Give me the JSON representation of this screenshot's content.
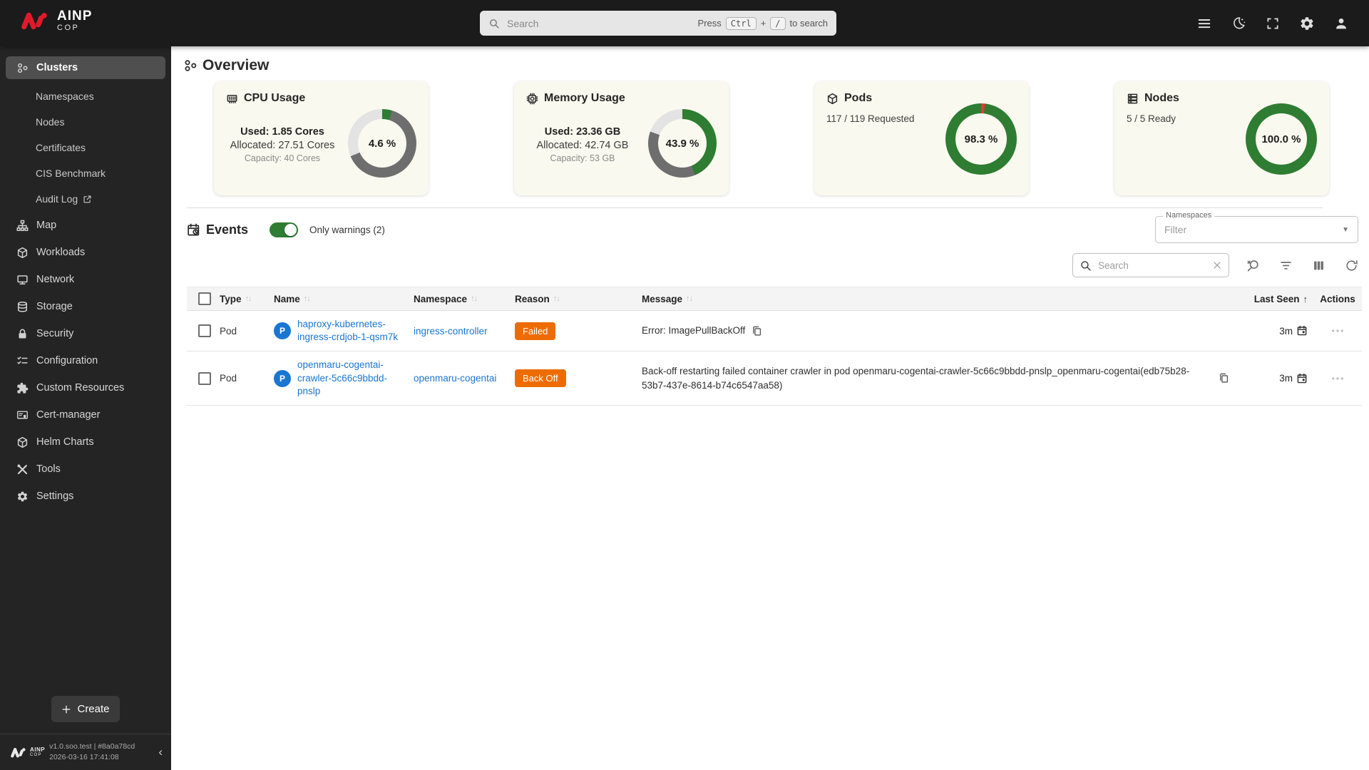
{
  "topbar": {
    "logo": {
      "primary": "AINP",
      "secondary": "COP"
    },
    "search": {
      "placeholder": "Search",
      "hint_press": "Press",
      "hint_key_ctrl": "Ctrl",
      "hint_plus": "+",
      "hint_key_slash": "/",
      "hint_suffix": "to search"
    }
  },
  "sidebar": {
    "items": [
      {
        "label": "Clusters",
        "icon": "cluster-icon",
        "selected": true
      },
      {
        "label": "Namespaces"
      },
      {
        "label": "Nodes"
      },
      {
        "label": "Certificates"
      },
      {
        "label": "CIS Benchmark"
      },
      {
        "label": "Audit Log",
        "icon": "external-link-icon"
      },
      {
        "label": "Map",
        "icon": "map-icon"
      },
      {
        "label": "Workloads",
        "icon": "workloads-icon"
      },
      {
        "label": "Network",
        "icon": "network-icon"
      },
      {
        "label": "Storage",
        "icon": "storage-icon"
      },
      {
        "label": "Security",
        "icon": "security-icon"
      },
      {
        "label": "Configuration",
        "icon": "configuration-icon"
      },
      {
        "label": "Custom Resources",
        "icon": "custom-resources-icon"
      },
      {
        "label": "Cert-manager",
        "icon": "cert-manager-icon"
      },
      {
        "label": "Helm Charts",
        "icon": "helm-charts-icon"
      },
      {
        "label": "Tools",
        "icon": "tools-icon"
      },
      {
        "label": "Settings",
        "icon": "settings-icon"
      }
    ],
    "create_label": "Create",
    "footer": {
      "version": "v1.0.soo.test | #8a0a78cd",
      "build_time": "2026-03-16 17:41:08"
    }
  },
  "page": {
    "title": "Overview"
  },
  "chart_data": [
    {
      "type": "donut",
      "title": "CPU Usage",
      "center_label": "4.6 %",
      "used_label": "Used: 1.85 Cores",
      "allocated_label": "Allocated: 27.51 Cores",
      "capacity_label": "Capacity: 40 Cores",
      "segments": [
        {
          "name": "used",
          "value": 4.6,
          "color": "#2e7d32"
        },
        {
          "name": "allocated",
          "value": 64.2,
          "color": "#6e6e6e"
        },
        {
          "name": "free",
          "value": 31.2,
          "color": "#e3e3e3"
        }
      ]
    },
    {
      "type": "donut",
      "title": "Memory Usage",
      "center_label": "43.9 %",
      "used_label": "Used: 23.36 GB",
      "allocated_label": "Allocated: 42.74 GB",
      "capacity_label": "Capacity: 53 GB",
      "segments": [
        {
          "name": "used",
          "value": 43.9,
          "color": "#2e7d32"
        },
        {
          "name": "allocated",
          "value": 36.7,
          "color": "#6e6e6e"
        },
        {
          "name": "free",
          "value": 19.4,
          "color": "#e3e3e3"
        }
      ]
    },
    {
      "type": "donut",
      "title": "Pods",
      "subtitle": "117 / 119 Requested",
      "center_label": "98.3 %",
      "segments": [
        {
          "name": "not-running",
          "value": 1.7,
          "color": "#e53935"
        },
        {
          "name": "running",
          "value": 98.3,
          "color": "#2e7d32"
        }
      ]
    },
    {
      "type": "donut",
      "title": "Nodes",
      "subtitle": "5 / 5 Ready",
      "center_label": "100.0 %",
      "segments": [
        {
          "name": "ready",
          "value": 100,
          "color": "#2e7d32"
        }
      ]
    }
  ],
  "events": {
    "title": "Events",
    "toggle_on": true,
    "warnings_toggle_label": "Only warnings (2)",
    "namespace_filter": {
      "label": "Namespaces",
      "placeholder": "Filter"
    },
    "toolbar": {
      "search_placeholder": "Search"
    },
    "table": {
      "columns": [
        {
          "label": "Type",
          "sort": "both"
        },
        {
          "label": "Name",
          "sort": "both"
        },
        {
          "label": "Namespace",
          "sort": "both"
        },
        {
          "label": "Reason",
          "sort": "both"
        },
        {
          "label": "Message",
          "sort": "both"
        },
        {
          "label": "Last Seen",
          "sort": "asc"
        },
        {
          "label": "Actions",
          "sort": "none"
        }
      ],
      "rows": [
        {
          "type": "Pod",
          "badge": "P",
          "name": "haproxy-kubernetes-ingress-crdjob-1-qsm7k",
          "namespace": "ingress-controller",
          "reason": "Failed",
          "message": "Error: ImagePullBackOff",
          "last_seen": "3m"
        },
        {
          "type": "Pod",
          "badge": "P",
          "name": "openmaru-cogentai-crawler-5c66c9bbdd-pnslp",
          "namespace": "openmaru-cogentai",
          "reason": "Back Off",
          "message": "Back-off restarting failed container crawler in pod openmaru-cogentai-crawler-5c66c9bbdd-pnslp_openmaru-cogentai(edb75b28-53b7-437e-8614-b74c6547aa58)",
          "last_seen": "3m"
        }
      ]
    }
  },
  "glyphs": {
    "sort_both": "↑↓",
    "sort_asc": "↑",
    "dropdown": "▼",
    "collapse": "‹"
  },
  "colors": {
    "brand_red": "#e01a2b",
    "accent_green": "#2e7d32",
    "warning_orange": "#ed6c02",
    "error_red": "#e53935",
    "link_blue": "#1976d2"
  }
}
